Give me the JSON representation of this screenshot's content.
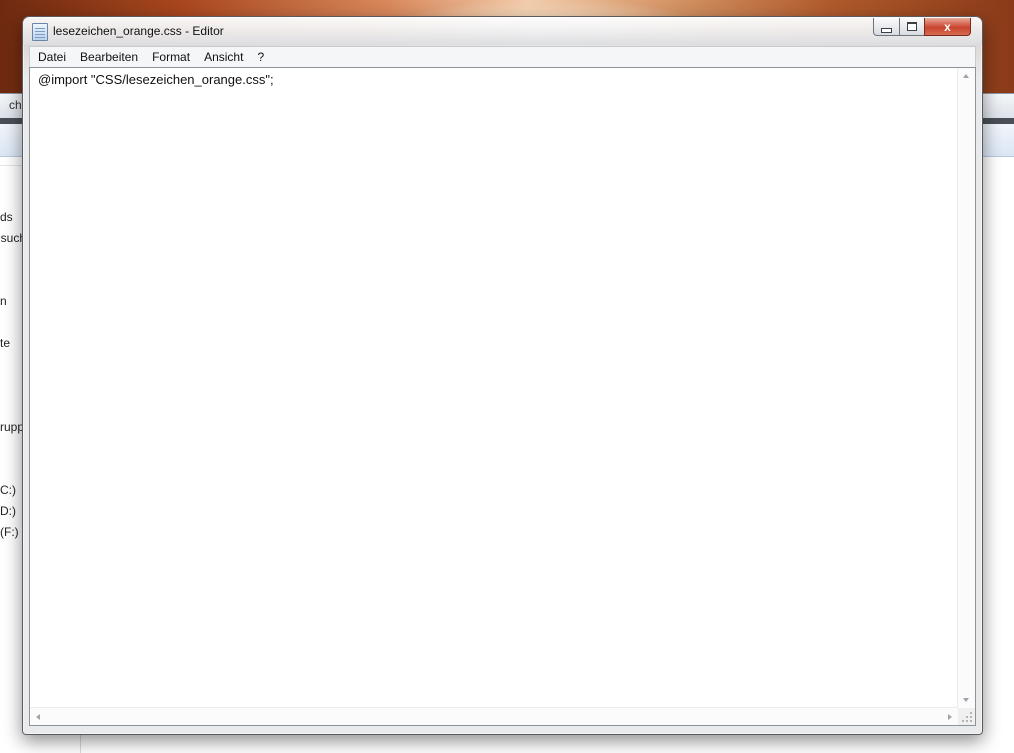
{
  "colors": {
    "window_frame": "#5b5b5f",
    "close_button": "#c8452f",
    "menubar_bg": "#f5f6f7",
    "editor_bg": "#ffffff"
  },
  "background": {
    "explorer_tab_text": "ch",
    "nav_items": [
      "ds",
      "esuch",
      "n",
      "te",
      "rupp",
      "C:)",
      "D:)",
      "(F:)"
    ]
  },
  "window": {
    "title": "lesezeichen_orange.css - Editor",
    "icon": "notepad-icon",
    "controls": {
      "minimize_icon": "minimize-icon",
      "maximize_icon": "maximize-icon",
      "close_label": "x"
    }
  },
  "menu": {
    "items": [
      "Datei",
      "Bearbeiten",
      "Format",
      "Ansicht",
      "?"
    ]
  },
  "editor": {
    "content": "@import \"CSS/lesezeichen_orange.css\";"
  }
}
